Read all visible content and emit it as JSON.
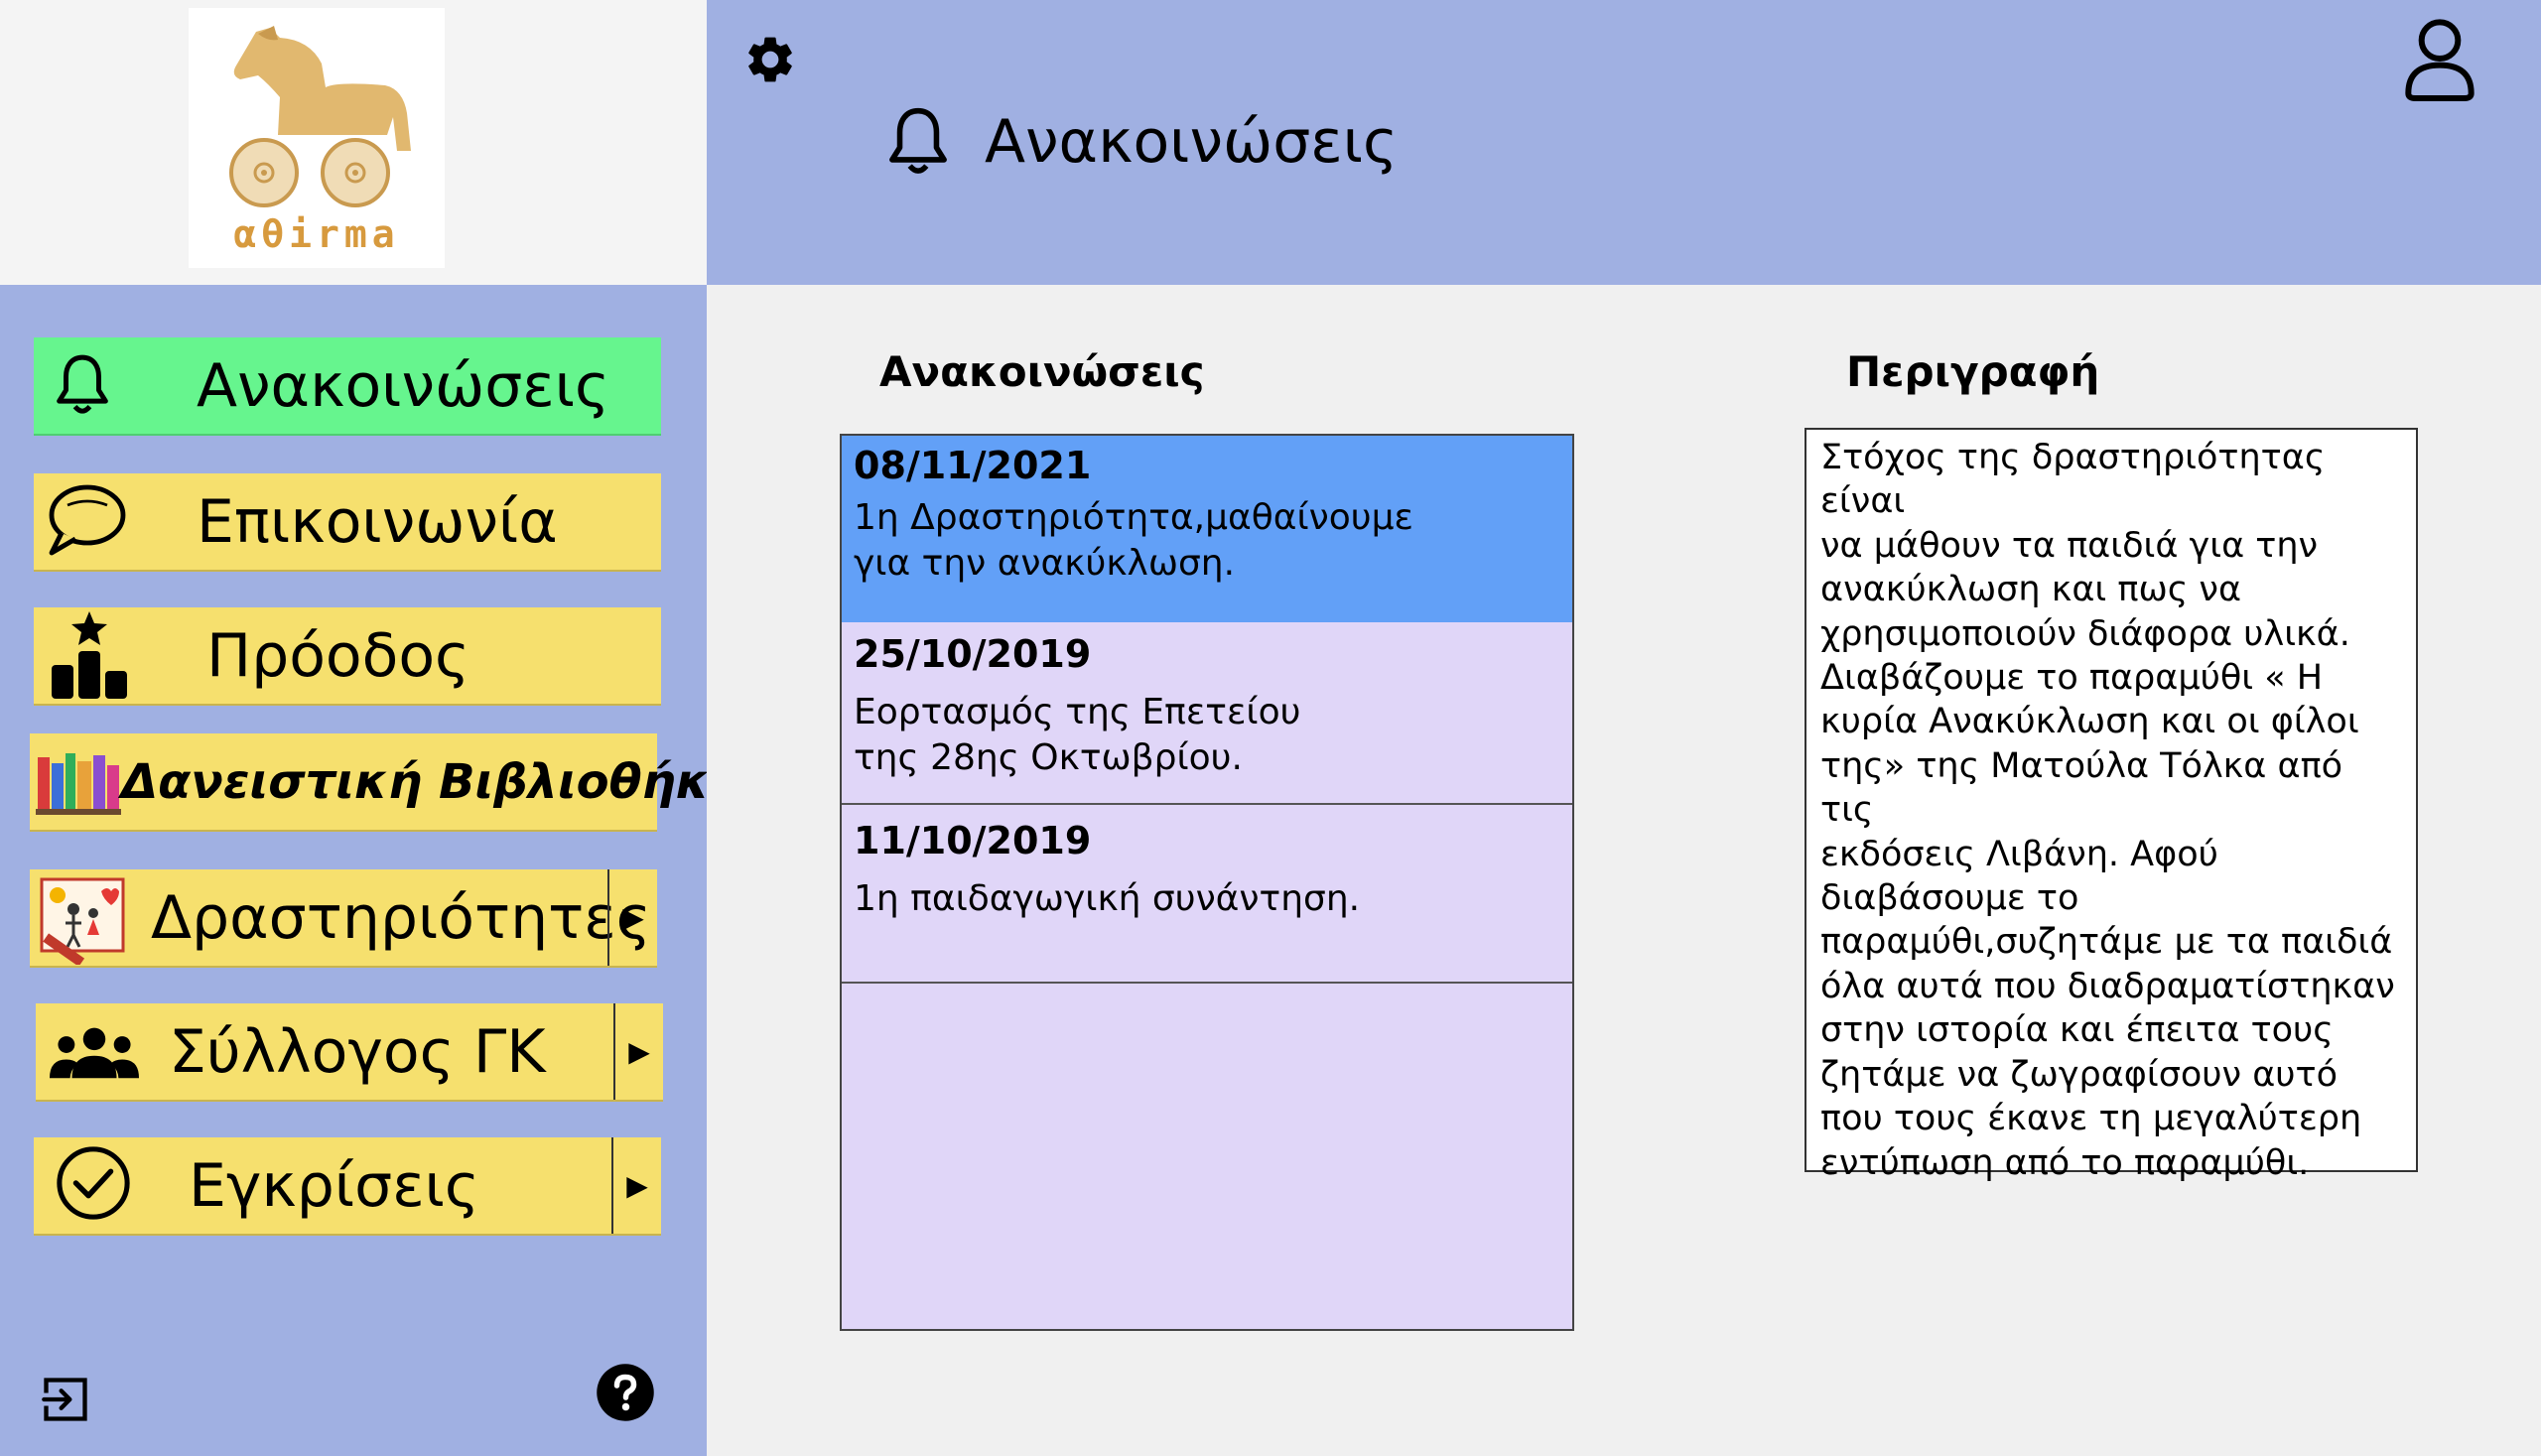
{
  "app": {
    "logo_text": "αθirma"
  },
  "header": {
    "title": "Ανακοινώσεις"
  },
  "sidebar": {
    "items": [
      {
        "label": "Ανακοινώσεις",
        "icon": "bell-icon",
        "active": true
      },
      {
        "label": "Επικοινωνία",
        "icon": "chat-bubble-icon"
      },
      {
        "label": "Πρόοδος",
        "icon": "podium-icon"
      },
      {
        "label": "Δανειστική Βιβλιοθήκη",
        "icon": "books-icon"
      },
      {
        "label": "Δραστηριότητες",
        "icon": "drawing-icon",
        "has_arrow": true
      },
      {
        "label": "Σύλλογος ΓΚ",
        "icon": "group-icon",
        "has_arrow": true
      },
      {
        "label": "Εγκρίσεις",
        "icon": "check-circle-icon",
        "has_arrow": true
      }
    ],
    "arrow_glyph": "▶"
  },
  "main": {
    "list_title": "Ανακοινώσεις",
    "desc_title": "Περιγραφή",
    "announcements": [
      {
        "date": "08/11/2021",
        "text_lines": [
          "1η Δραστηριότητα,μαθαίνουμε",
          "για την ανακύκλωση."
        ],
        "selected": true
      },
      {
        "date": "25/10/2019",
        "text_lines": [
          "Εορτασμός της Επετείου",
          "της 28ης Οκτωβρίου."
        ]
      },
      {
        "date": "11/10/2019",
        "text_lines": [
          "1η παιδαγωγική συνάντηση."
        ]
      }
    ],
    "description": "Στόχος της δραστηριότητας είναι\nνα μάθουν τα παιδιά για την\nανακύκλωση και πως να\nχρησιμοποιούν διάφορα υλικά.\nΔιαβάζουμε το παραμύθι « Η\nκυρία Ανακύκλωση και οι φίλοι\nτης» της Ματούλα Τόλκα από τις\nεκδόσεις Λιβάνη. Αφού\nδιαβάσουμε το\nπαραμύθι,συζητάμε με τα παιδιά\nόλα αυτά που διαδραματίστηκαν\nστην ιστορία και έπειτα τους\nζητάμε να ζωγραφίσουν αυτό\nπου τους έκανε τη μεγαλύτερη\nεντύπωση από το παραμύθι."
  },
  "colors": {
    "header_bg": "#a0b0e2",
    "active_nav": "#66f58e",
    "nav": "#f6e06e",
    "selected_row": "#62a0f7",
    "list_bg": "#e0d6f8"
  }
}
